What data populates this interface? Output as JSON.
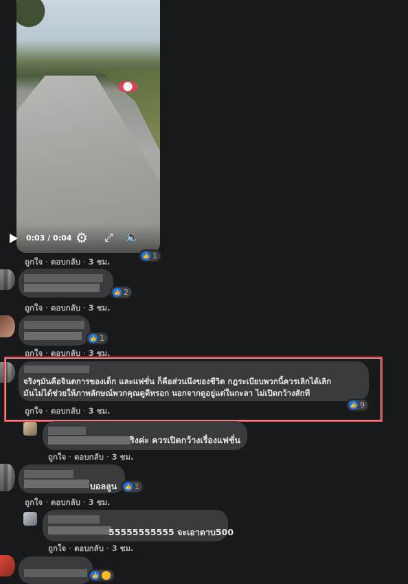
{
  "video": {
    "time": "0:03 / 0:04",
    "reaction_count": "1"
  },
  "actions": {
    "like": "ถูกใจ",
    "reply": "ตอบกลับ",
    "sep": "·"
  },
  "comments": [
    {
      "text": "",
      "time": "3 ชม.",
      "reactions": "2"
    },
    {
      "text": "",
      "time": "3 ชม.",
      "reactions": "1"
    },
    {
      "text_line1": "จริงๆมันคือจินตการของเด็ก และแฟชั่น ก็คือส่วนนึงของชีวิต กฎระเบียบพวกนี้ควรเลิกได้เลิก",
      "text_line2": "มันไม่ได้ช่วยให้ภาพลักษณ์พวกคุณดูดีหรอก นอกจากดูอยู่แต่ในกะลา ไม่เปิดกว้างสักที",
      "time": "3 ชม.",
      "reactions": "9"
    },
    {
      "text": "ริงค่ะ ควรเปิดกว้างเรื่องแฟชั่น",
      "time": "3 ชม."
    },
    {
      "text": "บอลลูน",
      "time": "3 ชม.",
      "reactions": "1"
    },
    {
      "text": "55555555555 จะเอาดาบ500",
      "time": "3 ชม."
    }
  ],
  "icons": {
    "play": "play-icon",
    "settings": "gear-icon",
    "fullscreen": "expand-icon",
    "mute": "speaker-mute-icon",
    "like": "thumbs-up-icon",
    "haha": "haha-icon"
  },
  "colors": {
    "background": "#18191a",
    "bubble": "#3a3b3c",
    "like_blue": "#1877f2",
    "highlight": "#e5474b"
  }
}
